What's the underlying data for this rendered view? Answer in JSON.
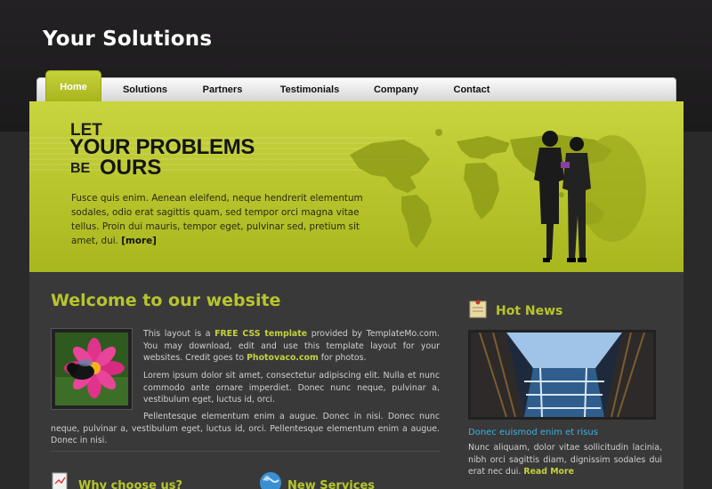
{
  "header": {
    "title": "Your Solutions"
  },
  "nav": {
    "items": [
      {
        "label": "Home"
      },
      {
        "label": "Solutions"
      },
      {
        "label": "Partners"
      },
      {
        "label": "Testimonials"
      },
      {
        "label": "Company"
      },
      {
        "label": "Contact"
      }
    ],
    "active_index": 0
  },
  "hero": {
    "line1": "LET",
    "line2": "YOUR PROBLEMS",
    "line3_small": "BE",
    "line3_big": "OURS",
    "body": "Fusce quis enim. Aenean eleifend, neque hendrerit elementum sodales, odio erat sagittis quam, sed tempor orci magna vitae tellus. Proin dui mauris, tempor eget, pulvinar sed, pretium sit amet, dui.",
    "more": "[more]"
  },
  "welcome": {
    "title": "Welcome to our website",
    "p1_a": "This layout is a ",
    "p1_link1": "FREE CSS template",
    "p1_b": " provided by TemplateMo.com. You may download, edit and use this template layout for your websites. Credit goes to ",
    "p1_link2": "Photovaco.com",
    "p1_c": " for photos.",
    "p2": "Lorem ipsum dolor sit amet, consectetur adipiscing elit. Nulla et nunc commodo ante ornare imperdiet. Donec nunc neque, pulvinar a, vestibulum eget, luctus id, orci.",
    "p3": "Pellentesque elementum enim a augue. Donec in nisi. Donec nunc neque, pulvinar a, vestibulum eget, luctus id, orci. Pellentesque elementum enim a augue. Donec in nisi."
  },
  "why": {
    "title": "Why choose us?"
  },
  "services": {
    "title": "New Services"
  },
  "sidebar": {
    "hot_news_title": "Hot News",
    "news_link": "Donec euismod enim et risus",
    "news_text": "Nunc aliquam, dolor vitae sollicitudin lacinia, nibh orci sagittis diam, dignissim sodales dui erat nec dui.",
    "read_more": "Read More"
  },
  "colors": {
    "accent_green": "#b7c52c",
    "link_blue": "#39b2e0",
    "background_dark": "#2b2a2b"
  }
}
